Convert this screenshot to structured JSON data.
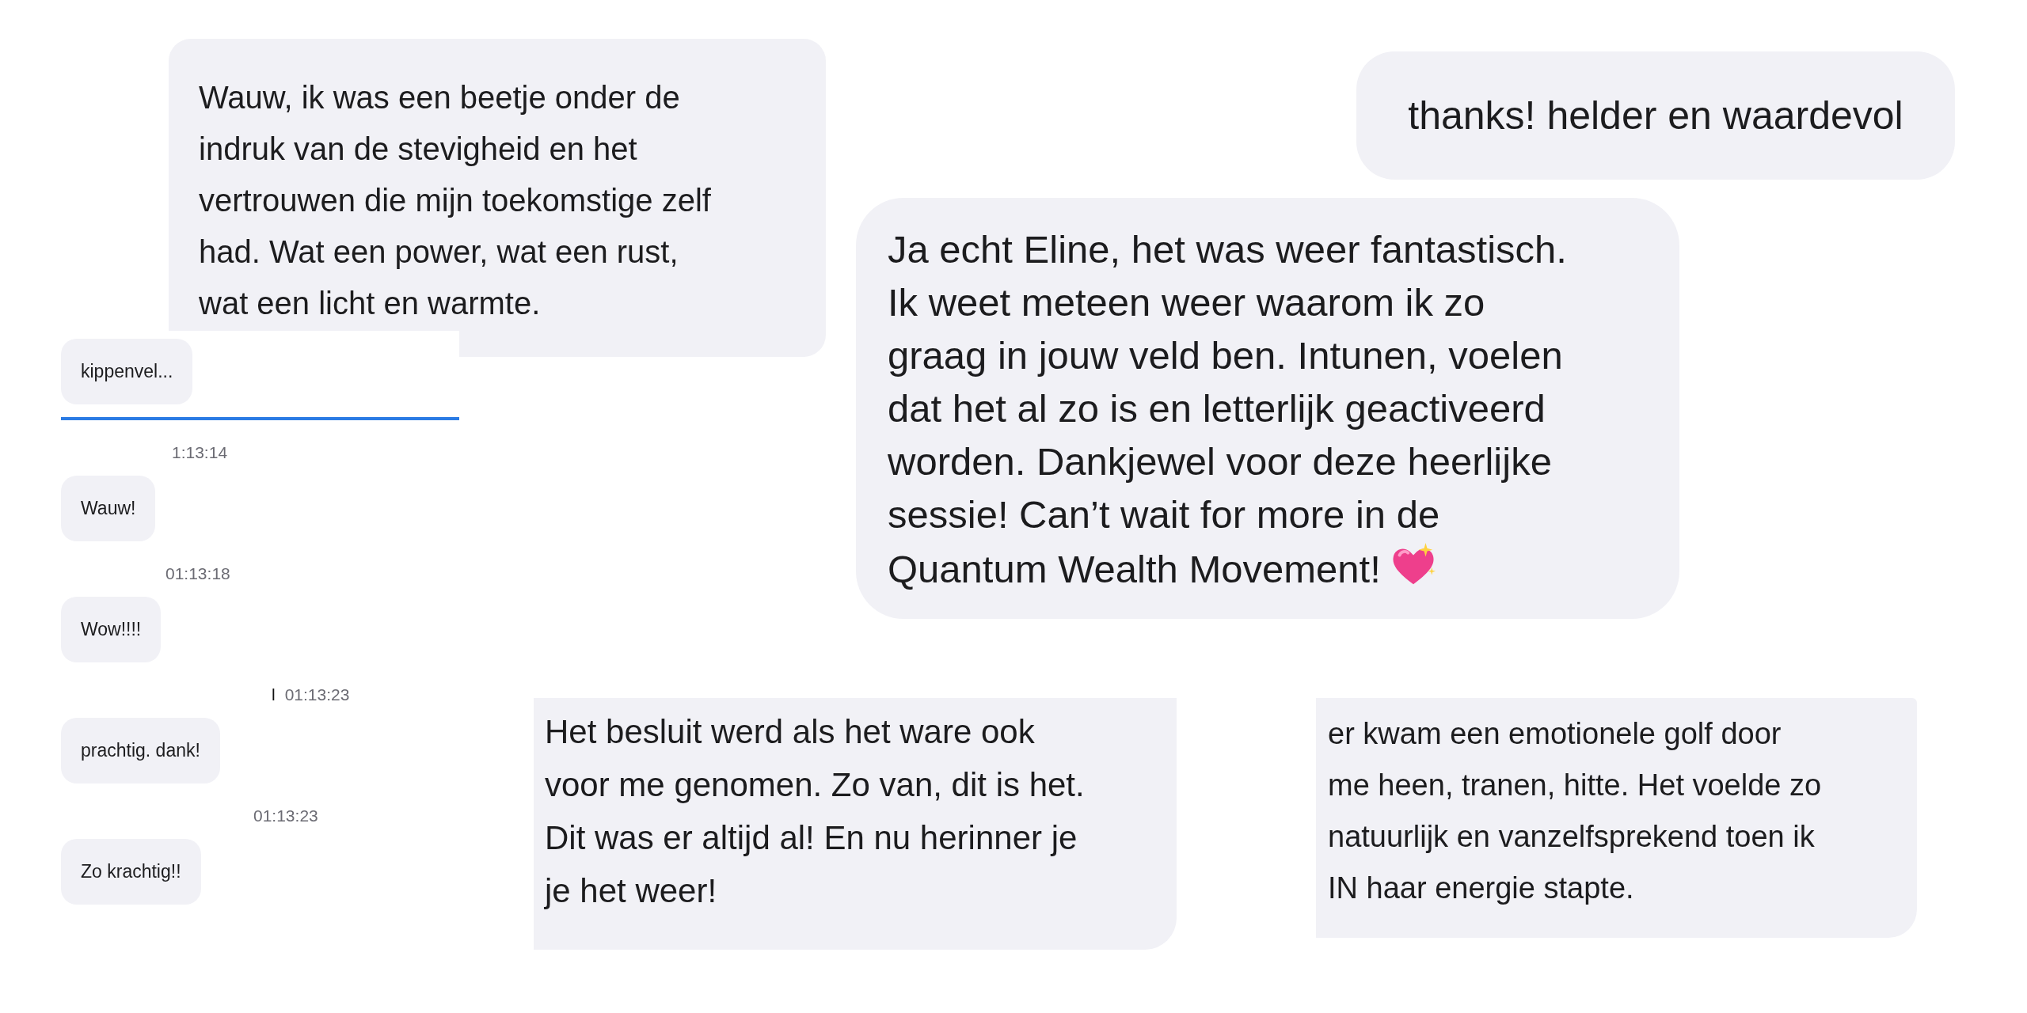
{
  "message_bubbles": [
    {
      "text": "Wauw, ik was een beetje onder de\nindruk van de stevigheid en het\nvertrouwen die mijn toekomstige zelf\nhad. Wat een power, wat een rust,\nwat een licht en warmte."
    },
    {
      "text": "thanks! helder en waardevol"
    },
    {
      "text": "Ja echt Eline, het was weer fantastisch.\nIk weet meteen weer waarom ik zo\ngraag in jouw veld ben. Intunen, voelen\ndat het al zo is en letterlijk geactiveerd\nworden. Dankjewel voor deze heerlijke\nsessie! Can’t wait for more in de\nQuantum Wealth Movement!",
      "emoji": true
    },
    {
      "text": "Het besluit werd als het ware ook\nvoor me genomen. Zo van, dit is het.\nDit was er altijd al! En nu herinner je\nje het weer!"
    },
    {
      "text": "er kwam een emotionele golf door\nme heen, tranen, hitte. Het voelde zo\nnatuurlijk en vanzelfsprekend toen ik\nIN haar energie stapte."
    }
  ],
  "chat_panel": {
    "messages": [
      {
        "text": "kippenvel..."
      },
      {
        "time": "1:13:14",
        "text": "Wauw!"
      },
      {
        "time": "01:13:18",
        "text": "Wow!!!!"
      },
      {
        "name_fragment": "l",
        "time": "01:13:23",
        "text": "prachtig. dank!"
      },
      {
        "time": "01:13:23",
        "text": "Zo krachtig!!"
      }
    ]
  }
}
